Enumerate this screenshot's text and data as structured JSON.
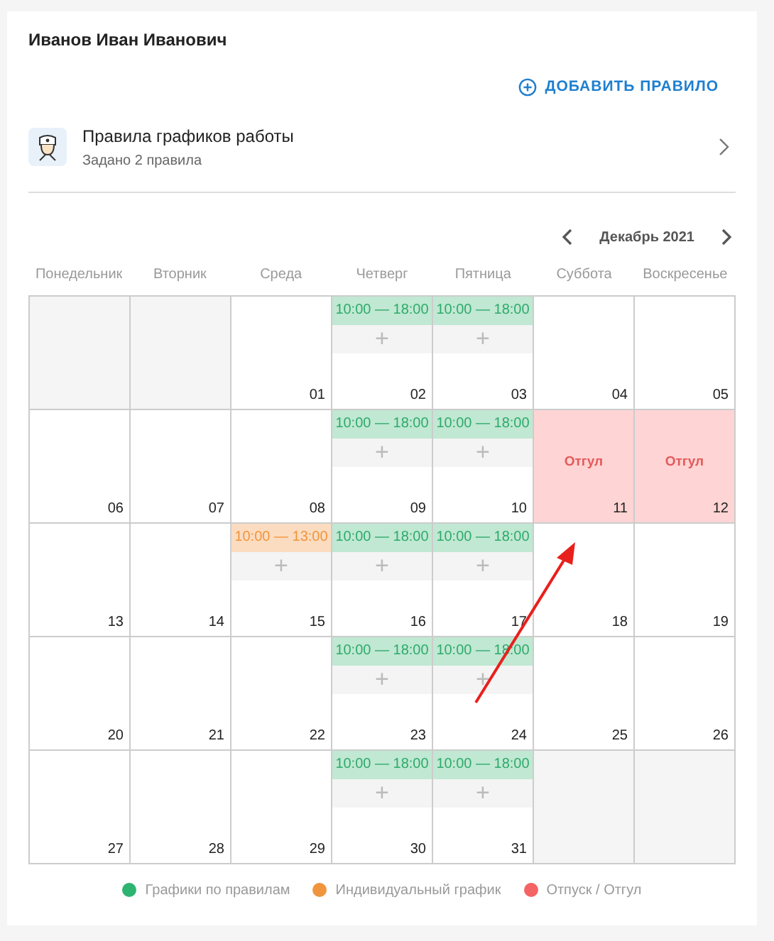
{
  "employee_name": "Иванов Иван Иванович",
  "add_rule_button": "ДОБАВИТЬ ПРАВИЛО",
  "rules": {
    "title": "Правила графиков работы",
    "subtitle": "Задано 2 правила"
  },
  "month": "Декабрь 2021",
  "weekdays": [
    "Понедельник",
    "Вторник",
    "Среда",
    "Четверг",
    "Пятница",
    "Суббота",
    "Воскресенье"
  ],
  "weeks": [
    [
      {
        "kind": "outside"
      },
      {
        "kind": "outside"
      },
      {
        "kind": "day",
        "day": "01"
      },
      {
        "kind": "day",
        "day": "02",
        "shift": {
          "kind": "rule",
          "time": "10:00 — 18:00",
          "add": "+"
        }
      },
      {
        "kind": "day",
        "day": "03",
        "shift": {
          "kind": "rule",
          "time": "10:00 — 18:00",
          "add": "+"
        }
      },
      {
        "kind": "day",
        "day": "04"
      },
      {
        "kind": "day",
        "day": "05"
      }
    ],
    [
      {
        "kind": "day",
        "day": "06"
      },
      {
        "kind": "day",
        "day": "07"
      },
      {
        "kind": "day",
        "day": "08"
      },
      {
        "kind": "day",
        "day": "09",
        "shift": {
          "kind": "rule",
          "time": "10:00 — 18:00",
          "add": "+"
        }
      },
      {
        "kind": "day",
        "day": "10",
        "shift": {
          "kind": "rule",
          "time": "10:00 — 18:00",
          "add": "+"
        }
      },
      {
        "kind": "day",
        "day": "11",
        "off": "Отгул"
      },
      {
        "kind": "day",
        "day": "12",
        "off": "Отгул"
      }
    ],
    [
      {
        "kind": "day",
        "day": "13"
      },
      {
        "kind": "day",
        "day": "14"
      },
      {
        "kind": "day",
        "day": "15",
        "shift": {
          "kind": "individual",
          "time": "10:00 — 13:00",
          "add": "+"
        }
      },
      {
        "kind": "day",
        "day": "16",
        "shift": {
          "kind": "rule",
          "time": "10:00 — 18:00",
          "add": "+"
        }
      },
      {
        "kind": "day",
        "day": "17",
        "shift": {
          "kind": "rule",
          "time": "10:00 — 18:00",
          "add": "+"
        }
      },
      {
        "kind": "day",
        "day": "18"
      },
      {
        "kind": "day",
        "day": "19"
      }
    ],
    [
      {
        "kind": "day",
        "day": "20"
      },
      {
        "kind": "day",
        "day": "21"
      },
      {
        "kind": "day",
        "day": "22"
      },
      {
        "kind": "day",
        "day": "23",
        "shift": {
          "kind": "rule",
          "time": "10:00 — 18:00",
          "add": "+"
        }
      },
      {
        "kind": "day",
        "day": "24",
        "shift": {
          "kind": "rule",
          "time": "10:00 — 18:00",
          "add": "+"
        }
      },
      {
        "kind": "day",
        "day": "25"
      },
      {
        "kind": "day",
        "day": "26"
      }
    ],
    [
      {
        "kind": "day",
        "day": "27"
      },
      {
        "kind": "day",
        "day": "28"
      },
      {
        "kind": "day",
        "day": "29"
      },
      {
        "kind": "day",
        "day": "30",
        "shift": {
          "kind": "rule",
          "time": "10:00 — 18:00",
          "add": "+"
        }
      },
      {
        "kind": "day",
        "day": "31",
        "shift": {
          "kind": "rule",
          "time": "10:00 — 18:00",
          "add": "+"
        }
      },
      {
        "kind": "outside"
      },
      {
        "kind": "outside"
      }
    ]
  ],
  "legend": [
    {
      "label": "Графики по правилам",
      "color": "#2eb471"
    },
    {
      "label": "Индивидуальный график",
      "color": "#f0953d"
    },
    {
      "label": "Отпуск / Отгул",
      "color": "#f46464"
    }
  ]
}
